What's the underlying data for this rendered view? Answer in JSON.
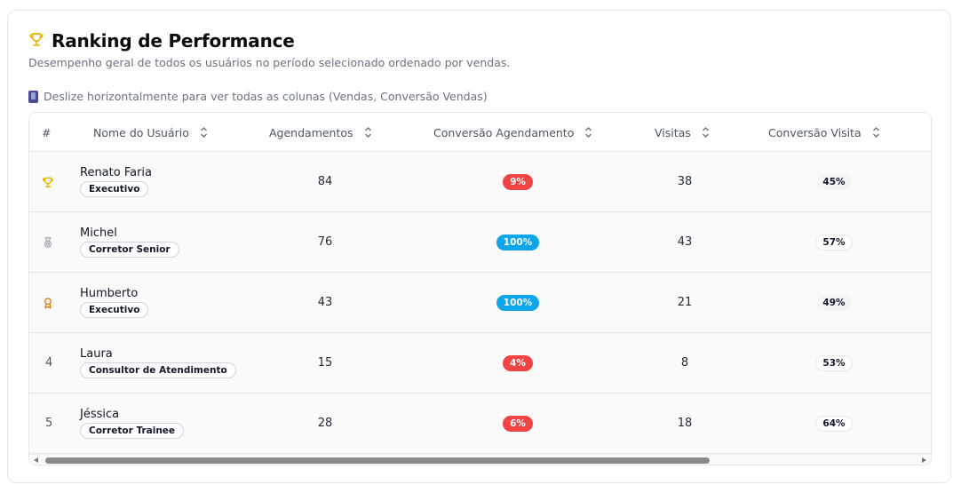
{
  "header": {
    "title": "Ranking de Performance",
    "subtitle": "Desempenho geral de todos os usuários no período selecionado ordenado por vendas.",
    "hint": "Deslize horizontalmente para ver todas as colunas (Vendas, Conversão Vendas)"
  },
  "columns": {
    "rank": "#",
    "name": "Nome do Usuário",
    "appointments": "Agendamentos",
    "appointment_conversion": "Conversão Agendamento",
    "visits": "Visitas",
    "visit_conversion": "Conversão Visita"
  },
  "rows": [
    {
      "rank_icon": "trophy-icon",
      "rank": "",
      "name": "Renato Faria",
      "role": "Executivo",
      "appointments": "84",
      "appointment_conversion": "9%",
      "appointment_conversion_style": "red",
      "visits": "38",
      "visit_conversion": "45%",
      "visit_conversion_style": "grey"
    },
    {
      "rank_icon": "medal-icon",
      "rank": "",
      "name": "Michel",
      "role": "Corretor Senior",
      "appointments": "76",
      "appointment_conversion": "100%",
      "appointment_conversion_style": "blue",
      "visits": "43",
      "visit_conversion": "57%",
      "visit_conversion_style": "outline"
    },
    {
      "rank_icon": "award-icon",
      "rank": "",
      "name": "Humberto",
      "role": "Executivo",
      "appointments": "43",
      "appointment_conversion": "100%",
      "appointment_conversion_style": "blue",
      "visits": "21",
      "visit_conversion": "49%",
      "visit_conversion_style": "grey"
    },
    {
      "rank_icon": "",
      "rank": "4",
      "name": "Laura",
      "role": "Consultor de Atendimento",
      "appointments": "15",
      "appointment_conversion": "4%",
      "appointment_conversion_style": "red",
      "visits": "8",
      "visit_conversion": "53%",
      "visit_conversion_style": "outline"
    },
    {
      "rank_icon": "",
      "rank": "5",
      "name": "Jéssica",
      "role": "Corretor Trainee",
      "appointments": "28",
      "appointment_conversion": "6%",
      "appointment_conversion_style": "red",
      "visits": "18",
      "visit_conversion": "64%",
      "visit_conversion_style": "outline"
    }
  ],
  "colors": {
    "gold": "#eab308",
    "silver": "#9ca3af",
    "bronze": "#d97706",
    "red": "#ef4444",
    "blue": "#0ea5e9"
  }
}
